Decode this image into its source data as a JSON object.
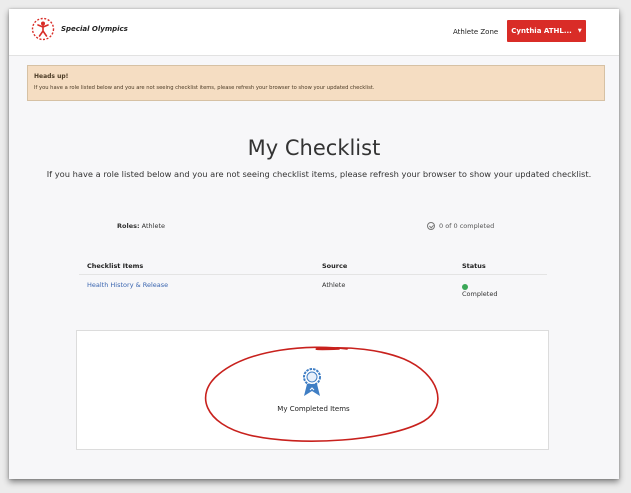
{
  "navbar": {
    "logo_text": "Special Olympics",
    "athlete_zone": "Athlete Zone",
    "user_button": "Cynthia ATHL..."
  },
  "alert": {
    "title": "Heads up!",
    "message": "If you have a role listed below and you are not seeing checklist items, please refresh your browser to show your updated checklist."
  },
  "page": {
    "title": "My Checklist",
    "subtitle": "If you have a role listed below and you are not seeing checklist items, please refresh your browser to show your updated checklist."
  },
  "roles": {
    "label": "Roles:",
    "value": "Athlete"
  },
  "progress": {
    "text": "0 of 0 completed"
  },
  "table": {
    "headers": [
      "Checklist Items",
      "Source",
      "Status"
    ],
    "rows": [
      {
        "item": "Health History & Release",
        "source": "Athlete",
        "status": "Completed"
      }
    ]
  },
  "completed_card": {
    "label": "My Completed Items"
  },
  "colors": {
    "brand_red": "#d92c27",
    "alert_bg": "#f5ddc2",
    "link_blue": "#3b66b0",
    "status_green": "#3aa757",
    "annotation_red": "#c8211d"
  },
  "icons": [
    "special-olympics-logo-icon",
    "dropdown-caret-icon",
    "check-circle-icon",
    "status-dot-icon",
    "award-ribbon-icon"
  ]
}
